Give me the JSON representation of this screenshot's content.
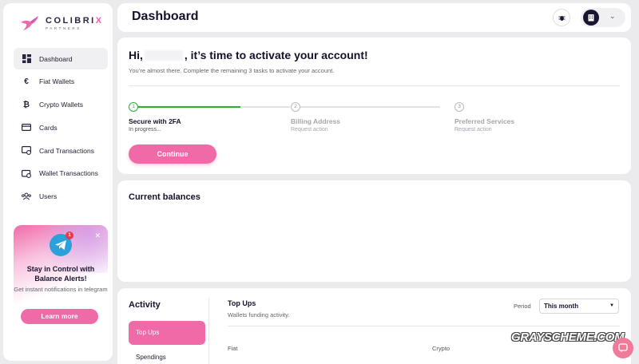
{
  "brand": {
    "name_prefix": "COLIBRI",
    "name_accent": "X",
    "subtitle": "PARTNERS",
    "accent_color": "#f06aa8"
  },
  "sidebar": {
    "items": [
      {
        "label": "Dashboard",
        "icon": "dashboard-icon",
        "active": true
      },
      {
        "label": "Fiat Wallets",
        "icon": "euro-icon"
      },
      {
        "label": "Crypto Wallets",
        "icon": "bitcoin-icon"
      },
      {
        "label": "Cards",
        "icon": "card-icon"
      },
      {
        "label": "Card Transactions",
        "icon": "card-transactions-icon"
      },
      {
        "label": "Wallet Transactions",
        "icon": "wallet-transactions-icon"
      },
      {
        "label": "Users",
        "icon": "users-icon"
      }
    ],
    "promo": {
      "badge": "1",
      "title": "Stay in Control with Balance Alerts!",
      "description": "Get instant notifications in telegram",
      "button": "Learn more"
    }
  },
  "header": {
    "title": "Dashboard"
  },
  "activation": {
    "greeting_start": "Hi,",
    "greeting_end": ", it’s time to activate your account!",
    "subtitle": "You’re almost there. Complete the remaining 3 tasks to activate your account.",
    "steps": [
      {
        "number": "1",
        "title": "Secure with 2FA",
        "status": "In progress...",
        "done": true
      },
      {
        "number": "2",
        "title": "Billing Address",
        "status": "Request action"
      },
      {
        "number": "3",
        "title": "Preferred Services",
        "status": "Request action"
      }
    ],
    "continue_button": "Continue"
  },
  "balances": {
    "title": "Current balances"
  },
  "activity": {
    "title": "Activity",
    "tabs": [
      "Top Ups",
      "Spendings"
    ],
    "heading": "Top Ups",
    "subheading": "Wallets funding activity.",
    "period_label": "Period",
    "period_value": "This month",
    "columns": [
      "Fiat",
      "Crypto"
    ]
  },
  "watermark": "GRAYSCHEME.COM"
}
